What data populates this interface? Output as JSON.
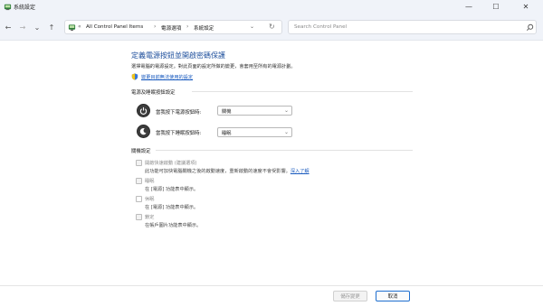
{
  "window": {
    "title": "系統設定",
    "minimize_glyph": "—",
    "maximize_glyph": "☐",
    "close_glyph": "✕"
  },
  "addressbar": {
    "back_glyph": "←",
    "forward_glyph": "→",
    "dropdown_glyph": "⌄",
    "up_glyph": "↑",
    "overflow": "«",
    "crumbs": [
      "All Control Panel Items",
      "電源選項",
      "系統設定"
    ],
    "separator": "›",
    "refresh_glyph": "↻",
    "search_placeholder": "Search Control Panel"
  },
  "main": {
    "heading": "定義電源按鈕並開啟密碼保護",
    "description": "選擇電腦的電源設定。對此頁面的設定所做的變更，會套用至所有的電源計劃。",
    "change_link": "變更目前無法使用的設定",
    "power_section": {
      "title": "電源及睡眠按鈕設定",
      "power_button_label": "當我按下電源按鈕時:",
      "power_button_value": "關機",
      "sleep_button_label": "當我按下睡眠按鈕時:",
      "sleep_button_value": "睡眠",
      "dropdown_glyph": "⌄"
    },
    "shutdown_section": {
      "title": "關機設定",
      "items": [
        {
          "label": "開啟快速啟動 (建議選項)",
          "desc": "此功能可加快電腦關機之後的啟動速度，重新啟動的速度不會受影響。",
          "link": "深入了解"
        },
        {
          "label": "睡眠",
          "desc": "在 [電源] 功能表中顯示。"
        },
        {
          "label": "休眠",
          "desc": "在 [電源] 功能表中顯示。"
        },
        {
          "label": "鎖定",
          "desc": "在帳戶圖片功能表中顯示。"
        }
      ]
    }
  },
  "footer": {
    "save_label": "儲存變更",
    "cancel_label": "取消"
  }
}
